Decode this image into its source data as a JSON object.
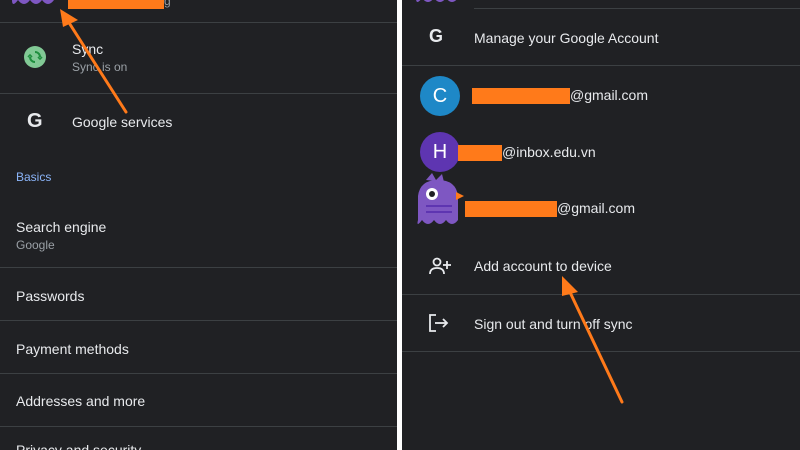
{
  "left": {
    "header_partial": "g",
    "sync": {
      "title": "Sync",
      "subtitle": "Sync is on"
    },
    "google_services": {
      "icon_letter": "G",
      "label": "Google services"
    },
    "basics_heading": "Basics",
    "search_engine": {
      "title": "Search engine",
      "value": "Google"
    },
    "passwords": "Passwords",
    "payment_methods": "Payment methods",
    "addresses": "Addresses and more",
    "privacy_partial": "Privacy and security"
  },
  "right": {
    "manage": {
      "icon_letter": "G",
      "label": "Manage your Google Account"
    },
    "accounts": [
      {
        "initial": "C",
        "suffix": "@gmail.com",
        "color": "#1e88c7"
      },
      {
        "initial": "H",
        "suffix": "@inbox.edu.vn",
        "color": "#5e35b1"
      },
      {
        "initial": "",
        "suffix": "@gmail.com",
        "color": "#7e57c2"
      }
    ],
    "add_account": "Add account to device",
    "sign_out": "Sign out and turn off sync"
  },
  "colors": {
    "background": "#202124",
    "divider": "#3c4043",
    "accent": "#8ab4f8",
    "redaction": "#ff7a1a",
    "arrow": "#ff7a1a"
  }
}
